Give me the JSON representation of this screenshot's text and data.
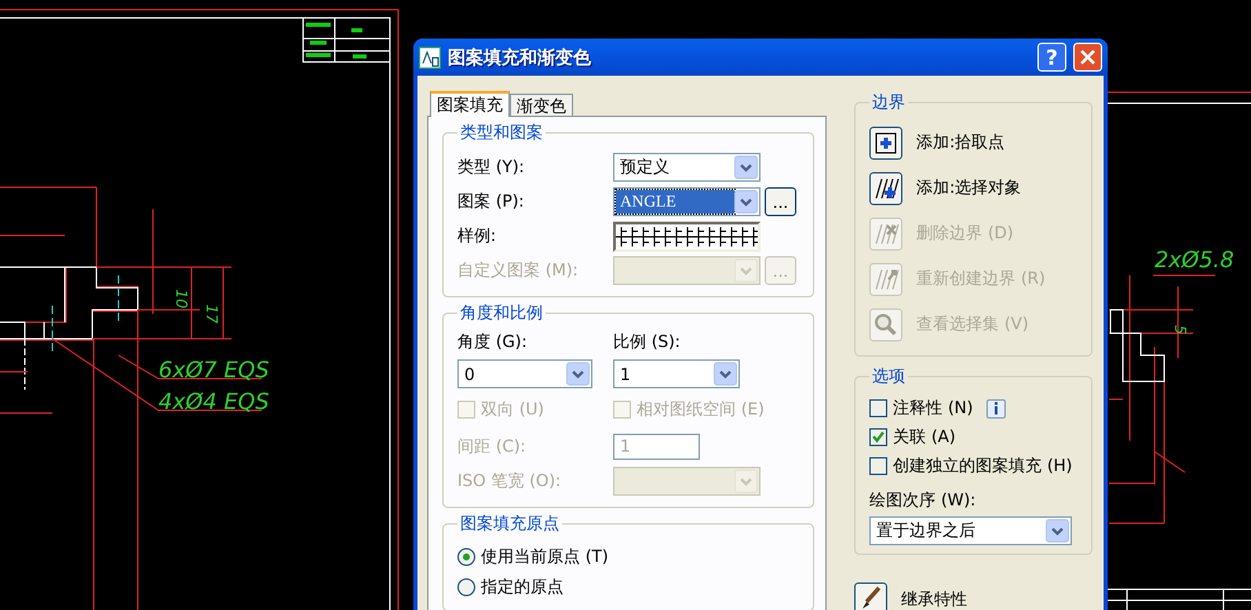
{
  "cad": {
    "labels": [
      {
        "kind": "note",
        "text": "6xØ7 EQS"
      },
      {
        "kind": "note",
        "text": "4xØ4 EQS"
      },
      {
        "kind": "note",
        "text": "2xØ5.8"
      },
      {
        "kind": "dim",
        "text": "10"
      },
      {
        "kind": "dim",
        "text": "17"
      },
      {
        "kind": "dim",
        "text": "5"
      }
    ]
  },
  "window": {
    "title": "图案填充和渐变色",
    "help": "?"
  },
  "tabs": [
    {
      "label": "图案填充",
      "selected": true
    },
    {
      "label": "渐变色",
      "selected": false
    }
  ],
  "type_and_pattern": {
    "title": "类型和图案",
    "rows": [
      {
        "kind": "combo",
        "label": "类型 (Y):",
        "value": "预定义",
        "highlighted": false,
        "disabled": false
      },
      {
        "kind": "combo",
        "label": "图案 (P):",
        "value": "ANGLE",
        "highlighted": true,
        "disabled": false,
        "button": "..."
      },
      {
        "kind": "swatch",
        "label": "样例:",
        "disabled": false
      },
      {
        "kind": "combo",
        "label": "自定义图案 (M):",
        "highlighted": false,
        "disabled": true,
        "button": "..."
      }
    ]
  },
  "angle_and_scale": {
    "title": "角度和比例",
    "angle": {
      "label": "角度 (G):",
      "value": "0"
    },
    "scale": {
      "label": "比例 (S):",
      "value": "1"
    },
    "checkboxes": [
      {
        "label": "双向 (U)",
        "checked": false,
        "disabled": true
      },
      {
        "label": "相对图纸空间 (E)",
        "checked": false,
        "disabled": true
      }
    ],
    "spacing": {
      "label": "间距 (C):",
      "value": "1",
      "disabled": true
    },
    "iso_pen": {
      "label": "ISO 笔宽 (O):",
      "disabled": true
    }
  },
  "origin": {
    "title": "图案填充原点",
    "options": [
      {
        "label": "使用当前原点 (T)",
        "selected": true
      },
      {
        "label": "指定的原点",
        "selected": false
      }
    ]
  },
  "boundary": {
    "title": "边界",
    "buttons": [
      {
        "kind": "pick",
        "label": "添加:拾取点",
        "disabled": false
      },
      {
        "kind": "select",
        "label": "添加:选择对象",
        "disabled": false
      },
      {
        "kind": "remove",
        "label": "删除边界 (D)",
        "disabled": true
      },
      {
        "kind": "recreate",
        "label": "重新创建边界 (R)",
        "disabled": true
      },
      {
        "kind": "view",
        "label": "查看选择集 (V)",
        "disabled": true
      }
    ]
  },
  "options": {
    "title": "选项",
    "checkboxes": [
      {
        "label": "注释性 (N)",
        "checked": false,
        "info": true
      },
      {
        "label": "关联 (A)",
        "checked": true,
        "info": false
      },
      {
        "label": "创建独立的图案填充 (H)",
        "checked": false,
        "info": false
      }
    ],
    "draw_order": {
      "label": "绘图次序 (W):",
      "value": "置于边界之后"
    }
  },
  "inherit": {
    "label": "继承特性"
  }
}
